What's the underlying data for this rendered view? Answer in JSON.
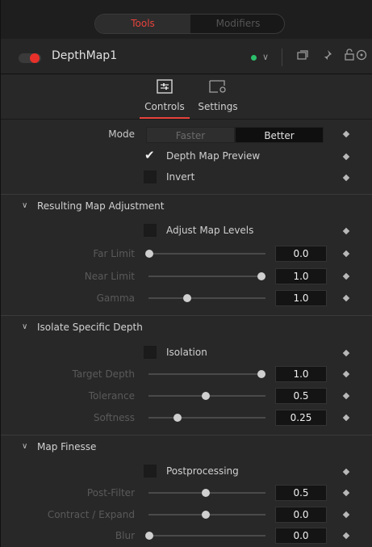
{
  "top_toggle": {
    "tools": "Tools",
    "modifiers": "Modifiers"
  },
  "node": {
    "name": "DepthMap1"
  },
  "tabs": {
    "controls": "Controls",
    "settings": "Settings"
  },
  "mode": {
    "label": "Mode",
    "options": [
      "Faster",
      "Better"
    ],
    "selected": "Better"
  },
  "checks": {
    "preview": {
      "label": "Depth Map Preview",
      "checked": true
    },
    "invert": {
      "label": "Invert",
      "checked": false
    }
  },
  "section1": {
    "title": "Resulting Map Adjustment",
    "adjust": {
      "label": "Adjust Map Levels",
      "checked": false
    },
    "far_limit": {
      "label": "Far Limit",
      "value": "0.0",
      "slider": 0.0
    },
    "near_limit": {
      "label": "Near Limit",
      "value": "1.0",
      "slider": 1.0
    },
    "gamma": {
      "label": "Gamma",
      "value": "1.0",
      "slider": 0.33
    }
  },
  "section2": {
    "title": "Isolate Specific Depth",
    "isolation": {
      "label": "Isolation",
      "checked": false
    },
    "target_depth": {
      "label": "Target Depth",
      "value": "1.0",
      "slider": 1.0
    },
    "tolerance": {
      "label": "Tolerance",
      "value": "0.5",
      "slider": 0.5
    },
    "softness": {
      "label": "Softness",
      "value": "0.25",
      "slider": 0.25
    }
  },
  "section3": {
    "title": "Map Finesse",
    "post": {
      "label": "Postprocessing",
      "checked": false
    },
    "post_filter": {
      "label": "Post-Filter",
      "value": "0.5",
      "slider": 0.5
    },
    "contract": {
      "label": "Contract / Expand",
      "value": "0.0",
      "slider": 0.5
    },
    "blur": {
      "label": "Blur",
      "value": "0.0",
      "slider": 0.0
    }
  },
  "colors": {
    "accent": "#e8433c",
    "status": "#2cbf6b"
  }
}
